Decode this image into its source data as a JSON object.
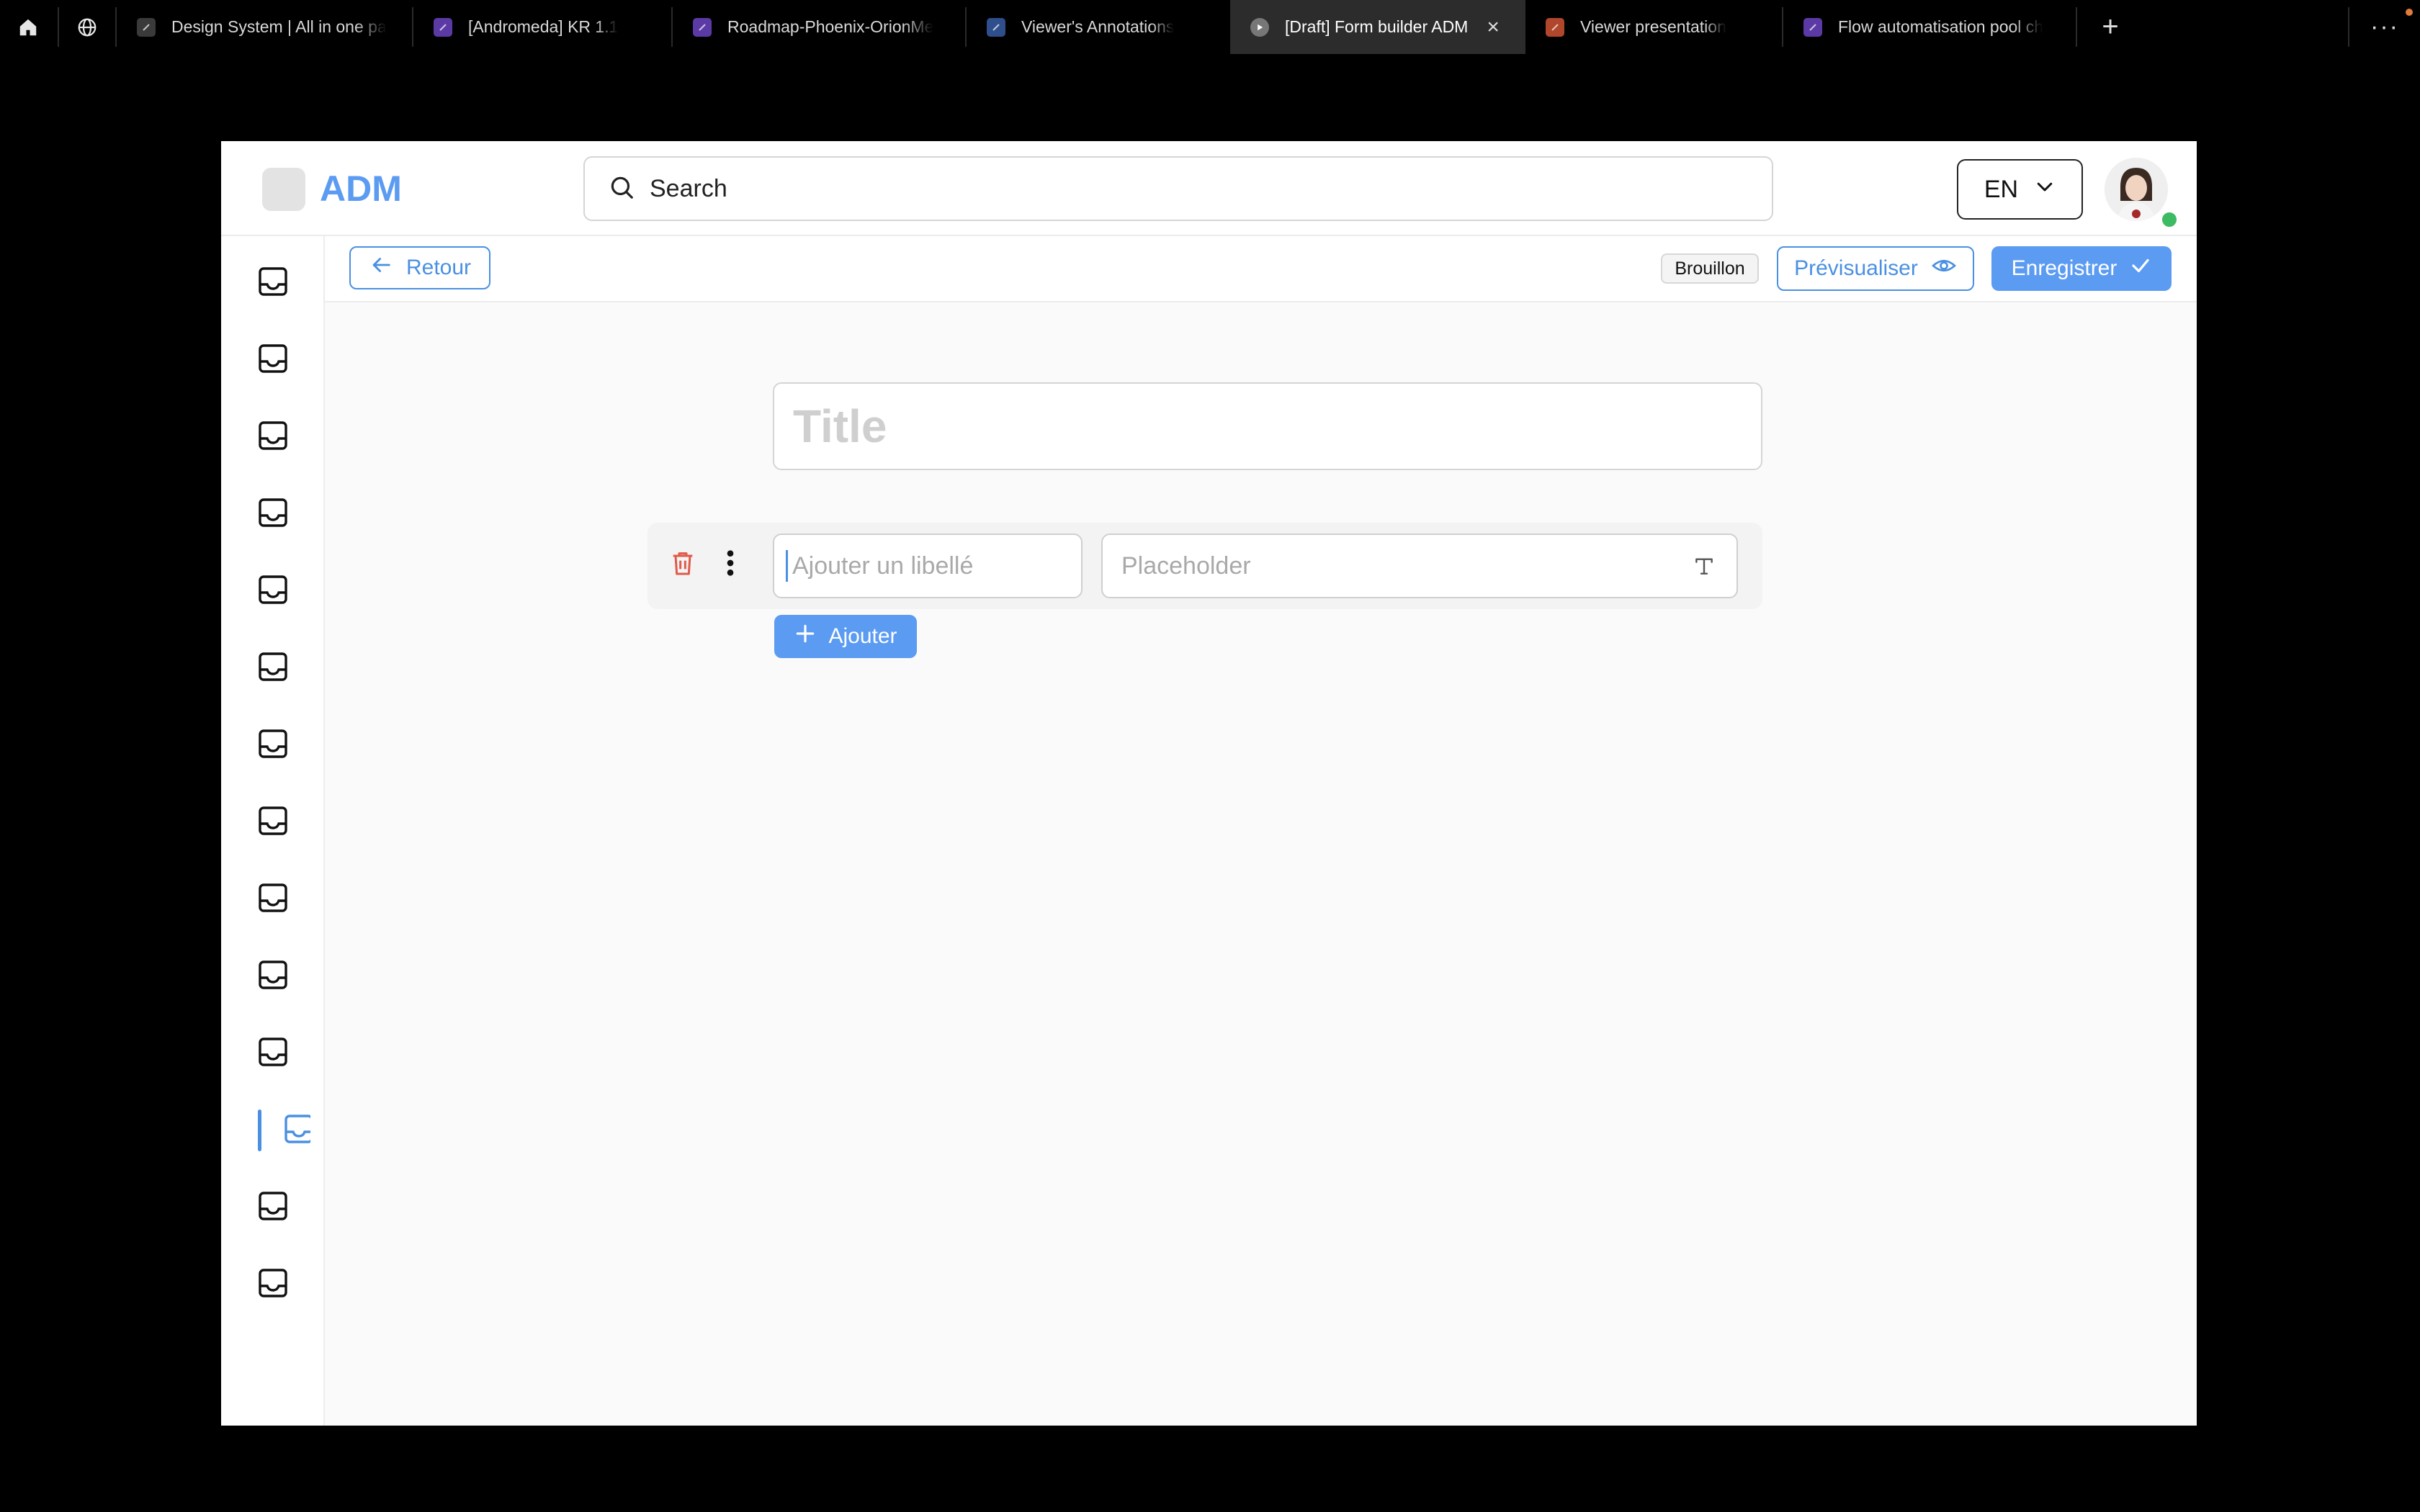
{
  "browser": {
    "tabs": [
      {
        "label": "Design System | All in one pa",
        "fav_color": "#3a3a3a"
      },
      {
        "label": "[Andromeda] KR 1.1",
        "fav_color": "#5b3aa6"
      },
      {
        "label": "Roadmap-Phoenix-OrionMe",
        "fav_color": "#5b3aa6"
      },
      {
        "label": "Viewer's Annotations",
        "fav_color": "#2f4e8c"
      },
      {
        "label": "[Draft] Form builder ADM",
        "fav_color": "#777777"
      },
      {
        "label": "Viewer presentation",
        "fav_color": "#b0462b"
      },
      {
        "label": "Flow automatisation pool ch",
        "fav_color": "#5b3aa6"
      }
    ],
    "active_tab_index": 4,
    "new_tab_label": "+",
    "more_label": "···"
  },
  "header": {
    "logo_text": "ADM",
    "search_placeholder": "Search",
    "language": "EN"
  },
  "sidebar": {
    "item_count": 14,
    "active_index": 11,
    "icon": "inbox-tray-icon"
  },
  "toolbar": {
    "back_label": "Retour",
    "status_badge": "Brouillon",
    "preview_label": "Prévisualiser",
    "save_label": "Enregistrer"
  },
  "form": {
    "title_placeholder": "Title",
    "field": {
      "label_placeholder": "Ajouter un libellé",
      "placeholder_placeholder": "Placeholder",
      "type_icon": "text-type-icon"
    },
    "add_label": "Ajouter"
  },
  "colors": {
    "accent": "#5b9bf2",
    "accent_border": "#4a90e2",
    "danger": "#e05a4a",
    "online": "#3dbb63"
  }
}
